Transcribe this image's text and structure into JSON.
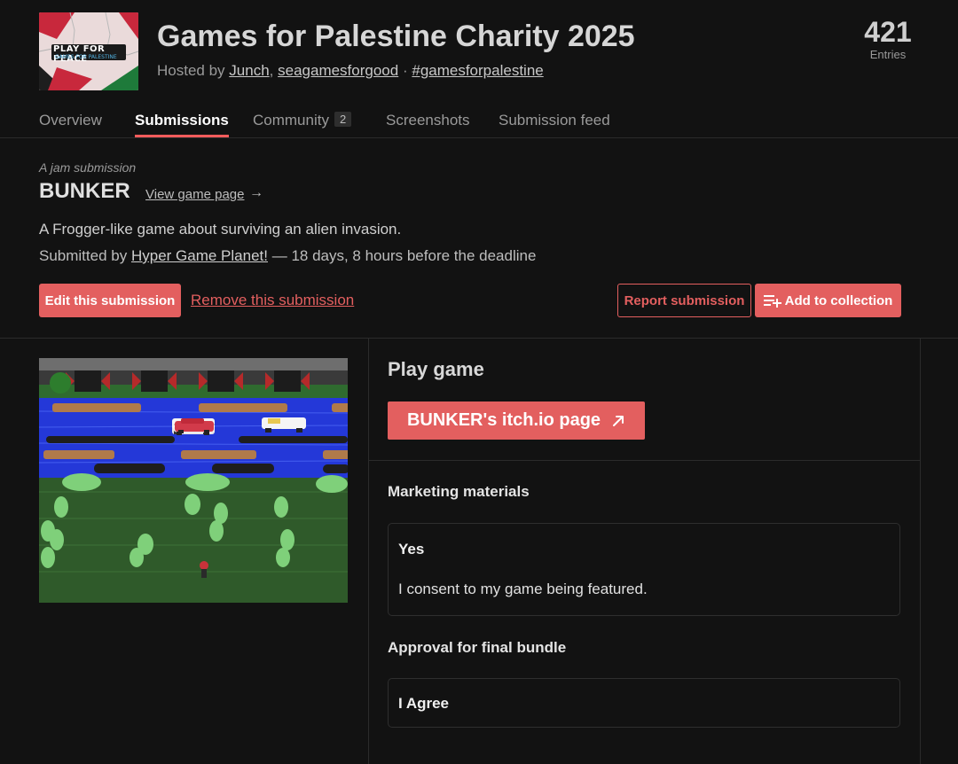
{
  "jam": {
    "logo_text_line1": "PLAY FOR PEACE",
    "logo_text_line2": "GAMES FOR PALESTINE",
    "title": "Games for Palestine Charity 2025",
    "hosted_prefix": "Hosted by",
    "hosts": [
      "Junch",
      "seagamesforgood"
    ],
    "host_separator": ",",
    "dot": "·",
    "hashtag": "#gamesforpalestine",
    "entries_count": "421",
    "entries_label": "Entries"
  },
  "tabs": [
    {
      "label": "Overview"
    },
    {
      "label": "Submissions",
      "active": true
    },
    {
      "label": "Community",
      "badge": "2"
    },
    {
      "label": "Screenshots"
    },
    {
      "label": "Submission feed"
    }
  ],
  "submission": {
    "kind": "A jam submission",
    "name": "BUNKER",
    "view_link": "View game page",
    "view_arrow": "→",
    "description": "A Frogger-like game about surviving an alien invasion.",
    "submitted_prefix": "Submitted by",
    "author": "Hyper Game Planet!",
    "submitted_suffix": "— 18 days, 8 hours before the deadline"
  },
  "actions": {
    "edit": "Edit this submission",
    "remove": "Remove this submission",
    "report": "Report submission",
    "add_collection": "Add to collection"
  },
  "play": {
    "title": "Play game",
    "button": "BUNKER's itch.io page",
    "button_icon": "external-link-arrow"
  },
  "questions": [
    {
      "title": "Marketing materials",
      "answer_strong": "Yes",
      "answer_text": "I consent to my game being featured."
    },
    {
      "title": "Approval for final bundle",
      "answer_strong": "I Agree"
    }
  ],
  "colors": {
    "accent": "#e35f5f",
    "background": "#121212"
  }
}
